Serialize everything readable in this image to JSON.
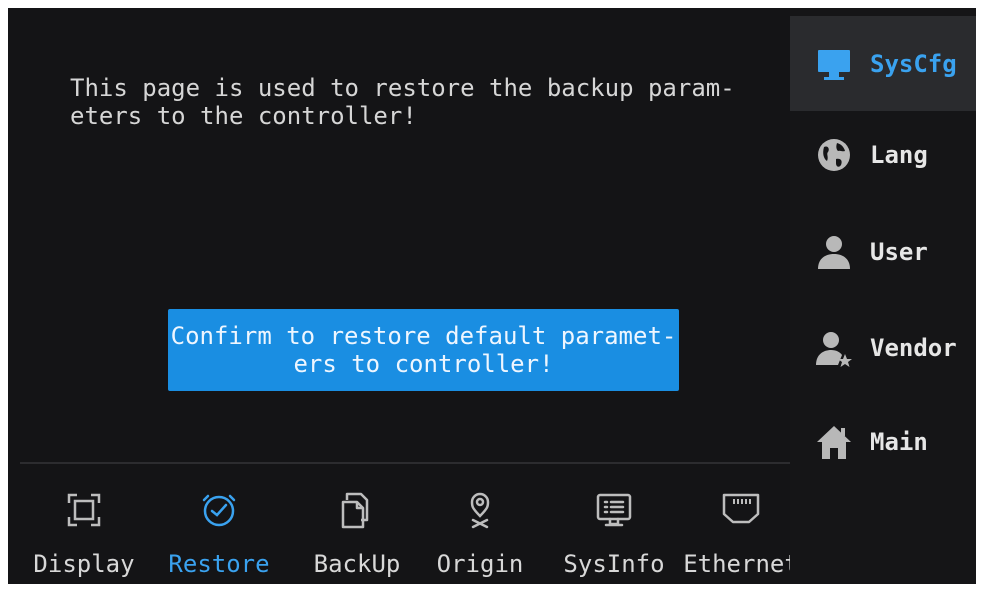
{
  "main": {
    "info_text": "This page is used to restore the backup param-\neters to the controller!",
    "confirm_label": "Confirm to restore default paramet-\ners to controller!"
  },
  "tabs": [
    {
      "label": "Display",
      "icon": "display-icon"
    },
    {
      "label": "Restore",
      "icon": "clock-icon",
      "active": true
    },
    {
      "label": "BackUp",
      "icon": "copy-icon"
    },
    {
      "label": "Origin",
      "icon": "location-pin-icon"
    },
    {
      "label": "SysInfo",
      "icon": "monitor-list-icon"
    },
    {
      "label": "Ethernet",
      "icon": "ethernet-port-icon"
    }
  ],
  "sidebar": {
    "items": [
      {
        "label": "SysCfg",
        "icon": "monitor-icon",
        "active": true
      },
      {
        "label": "Lang",
        "icon": "globe-icon"
      },
      {
        "label": "User",
        "icon": "user-icon"
      },
      {
        "label": "Vendor",
        "icon": "vendor-user-icon"
      },
      {
        "label": "Main",
        "icon": "home-icon"
      }
    ]
  },
  "colors": {
    "background": "#141416",
    "accent": "#1a8ee2",
    "active_text": "#3aa2ef",
    "text": "#d8d8d8",
    "sidebar_active_bg": "#2a2b2e"
  }
}
